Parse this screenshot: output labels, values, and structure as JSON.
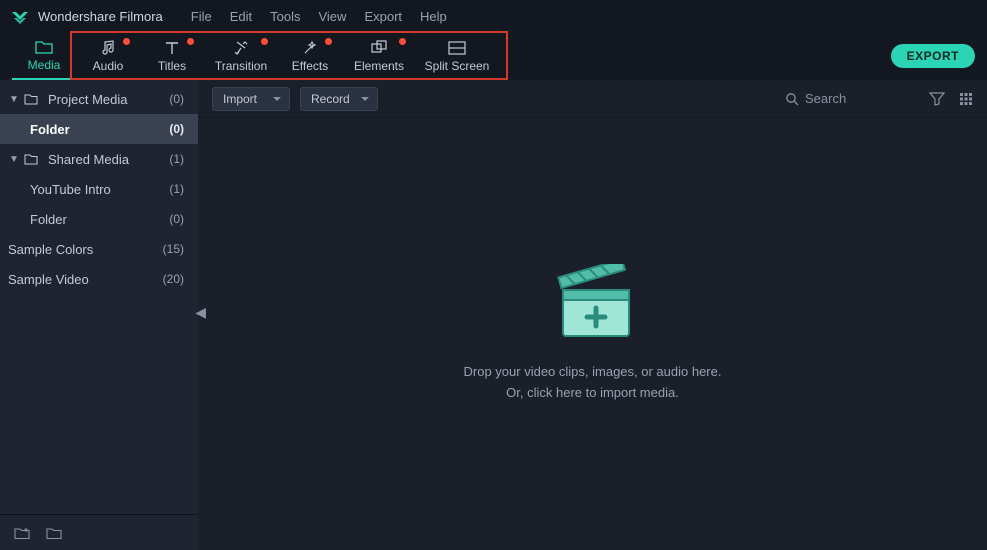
{
  "app": {
    "title": "Wondershare Filmora"
  },
  "menu": [
    "File",
    "Edit",
    "Tools",
    "View",
    "Export",
    "Help"
  ],
  "tabs": [
    {
      "id": "media",
      "label": "Media",
      "active": true,
      "dot": false
    },
    {
      "id": "audio",
      "label": "Audio",
      "active": false,
      "dot": true
    },
    {
      "id": "titles",
      "label": "Titles",
      "active": false,
      "dot": true
    },
    {
      "id": "transition",
      "label": "Transition",
      "active": false,
      "dot": true
    },
    {
      "id": "effects",
      "label": "Effects",
      "active": false,
      "dot": true
    },
    {
      "id": "elements",
      "label": "Elements",
      "active": false,
      "dot": true
    },
    {
      "id": "splitscreen",
      "label": "Split Screen",
      "active": false,
      "dot": false
    }
  ],
  "export_label": "EXPORT",
  "sidebar": {
    "items": [
      {
        "label": "Project Media",
        "count": "(0)",
        "level": 0,
        "expandable": true,
        "folder": true
      },
      {
        "label": "Folder",
        "count": "(0)",
        "level": 1,
        "selected": true
      },
      {
        "label": "Shared Media",
        "count": "(1)",
        "level": 0,
        "expandable": true,
        "folder": true
      },
      {
        "label": "YouTube Intro",
        "count": "(1)",
        "level": 1
      },
      {
        "label": "Folder",
        "count": "(0)",
        "level": 1
      },
      {
        "label": "Sample Colors",
        "count": "(15)",
        "level": 0
      },
      {
        "label": "Sample Video",
        "count": "(20)",
        "level": 0
      }
    ]
  },
  "toolbar": {
    "import_label": "Import",
    "record_label": "Record",
    "search_placeholder": "Search"
  },
  "dropzone": {
    "line1": "Drop your video clips, images, or audio here.",
    "line2": "Or, click here to import media."
  }
}
